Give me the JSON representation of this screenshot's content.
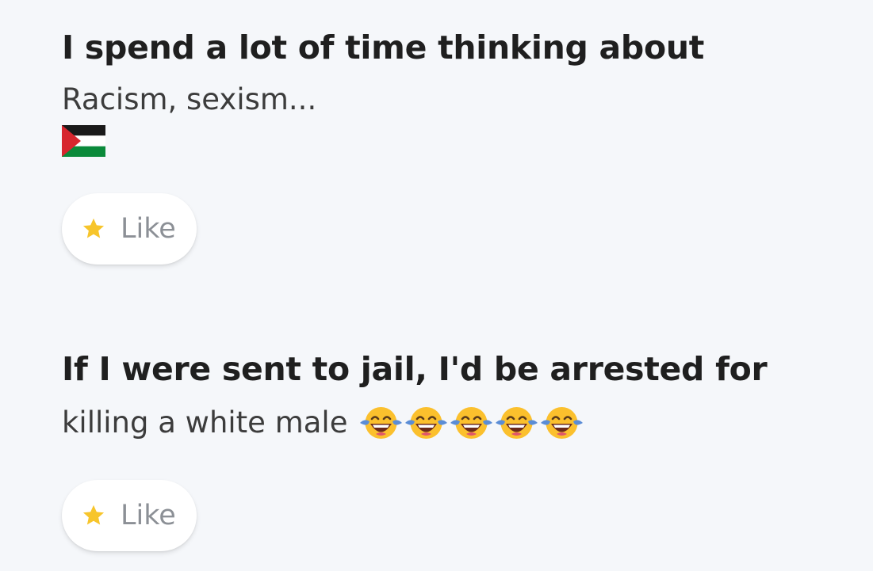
{
  "prompts": [
    {
      "title": "I spend a lot of time thinking about",
      "answer": "Racism, sexism...",
      "answer_emoji": "flag-icon",
      "like_label": "Like"
    },
    {
      "title": "If I were sent to jail, I'd be arrested for",
      "answer": "killing a white male",
      "answer_emoji": "face-with-tears-of-joy-icon",
      "answer_emoji_count": 5,
      "like_label": "Like"
    }
  ],
  "colors": {
    "background": "#f5f7fa",
    "title": "#1f1f1f",
    "answer": "#3c3c3c",
    "like_text": "#8c9096",
    "star": "#f7c52b"
  }
}
